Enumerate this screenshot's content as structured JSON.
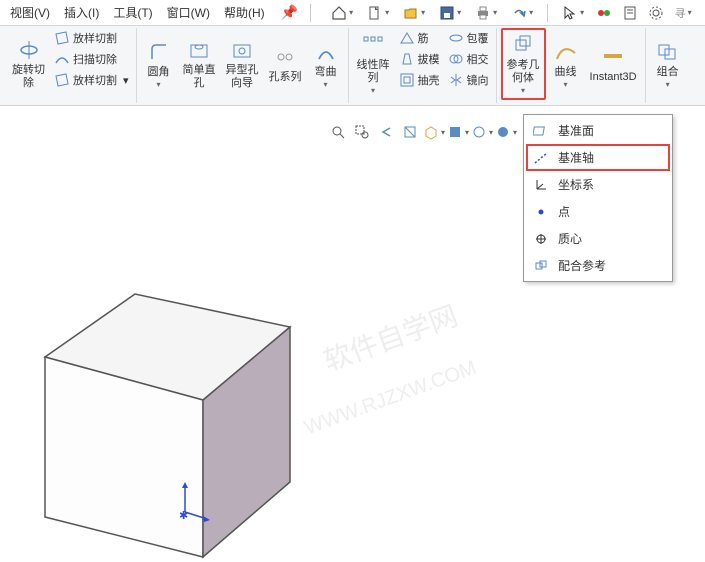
{
  "menubar": {
    "items": [
      {
        "label": "视图(V)"
      },
      {
        "label": "插入(I)"
      },
      {
        "label": "工具(T)"
      },
      {
        "label": "窗口(W)"
      },
      {
        "label": "帮助(H)"
      }
    ]
  },
  "quick_toolbar": {
    "home": "⌂",
    "new": "📄",
    "open": "📂",
    "save": "💾",
    "print": "🖨",
    "undo": "↶",
    "cursor": "↖",
    "rebuild": "🔧",
    "traffic": "🚦",
    "options": "⚙",
    "search": "寻"
  },
  "ribbon": {
    "rotate_cut": {
      "label": "旋转切\n除"
    },
    "loft_cut": {
      "label": "放样切割"
    },
    "sweep_cut": {
      "label": "扫描切除"
    },
    "loft_cut2": {
      "label": "放样切割"
    },
    "fillet": {
      "label": "圆角"
    },
    "hole_simple": {
      "label": "简单直\n孔"
    },
    "hole_wizard": {
      "label": "异型孔\n向导"
    },
    "hole_series": {
      "label": "孔系列"
    },
    "bend": {
      "label": "弯曲"
    },
    "linear_pattern": {
      "label": "线性阵\n列"
    },
    "rib": {
      "label": "筋"
    },
    "draft": {
      "label": "拔模"
    },
    "shell": {
      "label": "抽壳"
    },
    "wrap": {
      "label": "包覆"
    },
    "intersect": {
      "label": "相交"
    },
    "mirror": {
      "label": "镜向"
    },
    "ref_geom": {
      "label": "参考几\n何体"
    },
    "curve": {
      "label": "曲线"
    },
    "instant3d": {
      "label": "Instant3D"
    },
    "combine": {
      "label": "组合"
    }
  },
  "dropdown": {
    "items": [
      {
        "label": "基准面"
      },
      {
        "label": "基准轴"
      },
      {
        "label": "坐标系"
      },
      {
        "label": "点"
      },
      {
        "label": "质心"
      },
      {
        "label": "配合参考"
      }
    ]
  },
  "watermark": {
    "line1": "软件自学网",
    "line2": "WWW.RJZXW.COM"
  }
}
